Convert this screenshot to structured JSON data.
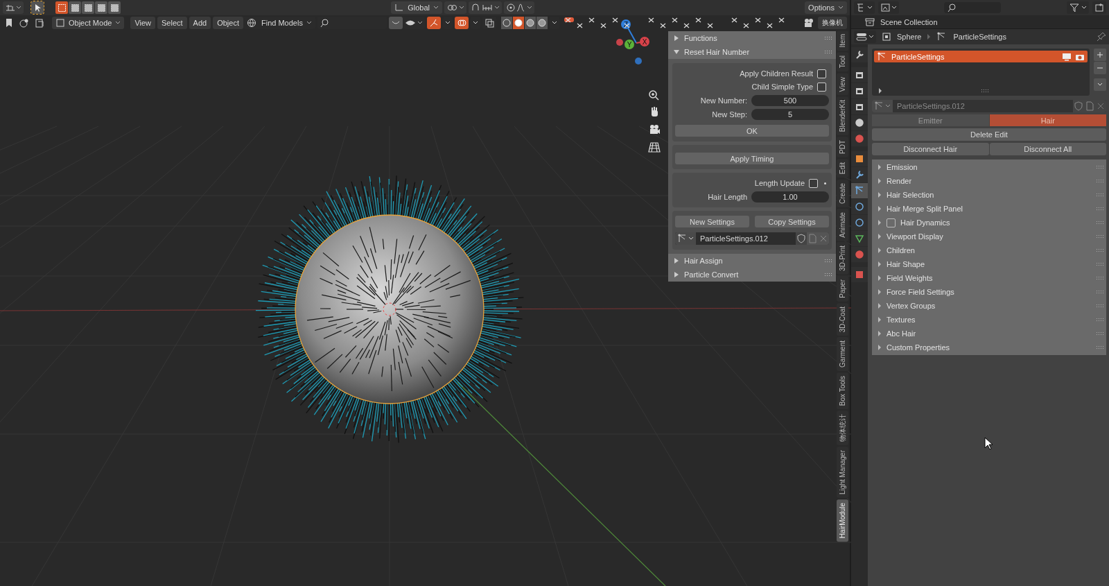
{
  "top_bar": {
    "select_modes": [
      {
        "selected": true
      },
      {
        "selected": false
      },
      {
        "selected": false
      },
      {
        "selected": false
      },
      {
        "selected": false
      }
    ],
    "orientation": "Global",
    "options": "Options"
  },
  "header": {
    "mode": "Object Mode",
    "menus": [
      "View",
      "Select",
      "Add",
      "Object"
    ],
    "find_models": "Find Models",
    "shading": [
      {
        "selected": false
      },
      {
        "selected": true
      },
      {
        "selected": false
      },
      {
        "selected": false
      }
    ],
    "camera_button": "换像机"
  },
  "gizmo": [
    {
      "label": "Z",
      "color": "#2f7fdc"
    },
    {
      "label": "Y",
      "color": "#5cb23a"
    },
    {
      "label": "X",
      "color": "#d9434a"
    }
  ],
  "n_panel": {
    "top_panels": [
      {
        "title": "Functions",
        "expanded": false
      },
      {
        "title": "Reset Hair Number",
        "expanded": true
      }
    ],
    "checkboxes": [
      {
        "label": "Apply Children Result",
        "checked": false
      },
      {
        "label": "Child Simple Type",
        "checked": false
      }
    ],
    "fields": [
      {
        "label": "New Number:",
        "value": "500"
      },
      {
        "label": "New Step:",
        "value": "5"
      }
    ],
    "ok_button": "OK",
    "timing_button": "Apply Timing",
    "length_update": {
      "label": "Length Update",
      "checked": false
    },
    "hair_length": {
      "label": "Hair Length",
      "value": "1.00"
    },
    "settings_buttons": [
      "New Settings",
      "Copy Settings"
    ],
    "datablock": "ParticleSettings.012",
    "bottom_panels": [
      {
        "title": "Hair Assign",
        "expanded": false
      },
      {
        "title": "Particle Convert",
        "expanded": false
      }
    ]
  },
  "tabs": [
    {
      "label": "Item",
      "selected": false
    },
    {
      "label": "Tool",
      "selected": false
    },
    {
      "label": "View",
      "selected": false
    },
    {
      "label": "BlenderKit",
      "selected": false
    },
    {
      "label": "PDT",
      "selected": false
    },
    {
      "label": "Edit",
      "selected": false
    },
    {
      "label": "Create",
      "selected": false
    },
    {
      "label": "Animate",
      "selected": false
    },
    {
      "label": "3D-Print",
      "selected": false
    },
    {
      "label": "Paper",
      "selected": false
    },
    {
      "label": "3D-Coat",
      "selected": false
    },
    {
      "label": "Garment",
      "selected": false
    },
    {
      "label": "Box Tools",
      "selected": false
    },
    {
      "label": "物体统计",
      "selected": false
    },
    {
      "label": "Light Manager",
      "selected": false
    },
    {
      "label": "HairModule",
      "selected": true
    }
  ],
  "outliner": {
    "collection": "Scene Collection"
  },
  "properties": {
    "breadcrumb": [
      "Sphere",
      "ParticleSettings"
    ],
    "tabs": [
      {
        "kind": "tool",
        "selected": false
      },
      {
        "kind": "render",
        "selected": false
      },
      {
        "kind": "output",
        "selected": false
      },
      {
        "kind": "view_layer",
        "selected": false
      },
      {
        "kind": "scene",
        "selected": false
      },
      {
        "kind": "world",
        "selected": false
      },
      {
        "kind": "object",
        "selected": false
      },
      {
        "kind": "modifier",
        "selected": false
      },
      {
        "kind": "particles",
        "selected": true
      },
      {
        "kind": "physics",
        "selected": false
      },
      {
        "kind": "constraints",
        "selected": false
      },
      {
        "kind": "data",
        "selected": false
      },
      {
        "kind": "material",
        "selected": false
      },
      {
        "kind": "texture",
        "selected": false
      }
    ],
    "systems": [
      {
        "name": "ParticleSettings",
        "selected": true
      }
    ],
    "datablock": "ParticleSettings.012",
    "types": [
      {
        "label": "Emitter",
        "selected": false
      },
      {
        "label": "Hair",
        "selected": true
      }
    ],
    "delete_button": "Delete Edit",
    "disconnect_buttons": [
      "Disconnect Hair",
      "Disconnect All"
    ],
    "panels": [
      {
        "title": "Emission",
        "kind": "plain"
      },
      {
        "title": "Render",
        "kind": "plain"
      },
      {
        "title": "Hair Selection",
        "kind": "plain"
      },
      {
        "title": "Hair Merge Split Panel",
        "kind": "plain"
      },
      {
        "title": "Hair Dynamics",
        "kind": "checkbox",
        "checked": false
      },
      {
        "title": "Viewport Display",
        "kind": "plain"
      },
      {
        "title": "Children",
        "kind": "plain"
      },
      {
        "title": "Hair Shape",
        "kind": "plain"
      },
      {
        "title": "Field Weights",
        "kind": "plain"
      },
      {
        "title": "Force Field Settings",
        "kind": "plain"
      },
      {
        "title": "Vertex Groups",
        "kind": "plain"
      },
      {
        "title": "Textures",
        "kind": "plain"
      },
      {
        "title": "Abc Hair",
        "kind": "plain"
      },
      {
        "title": "Custom Properties",
        "kind": "plain"
      }
    ]
  }
}
